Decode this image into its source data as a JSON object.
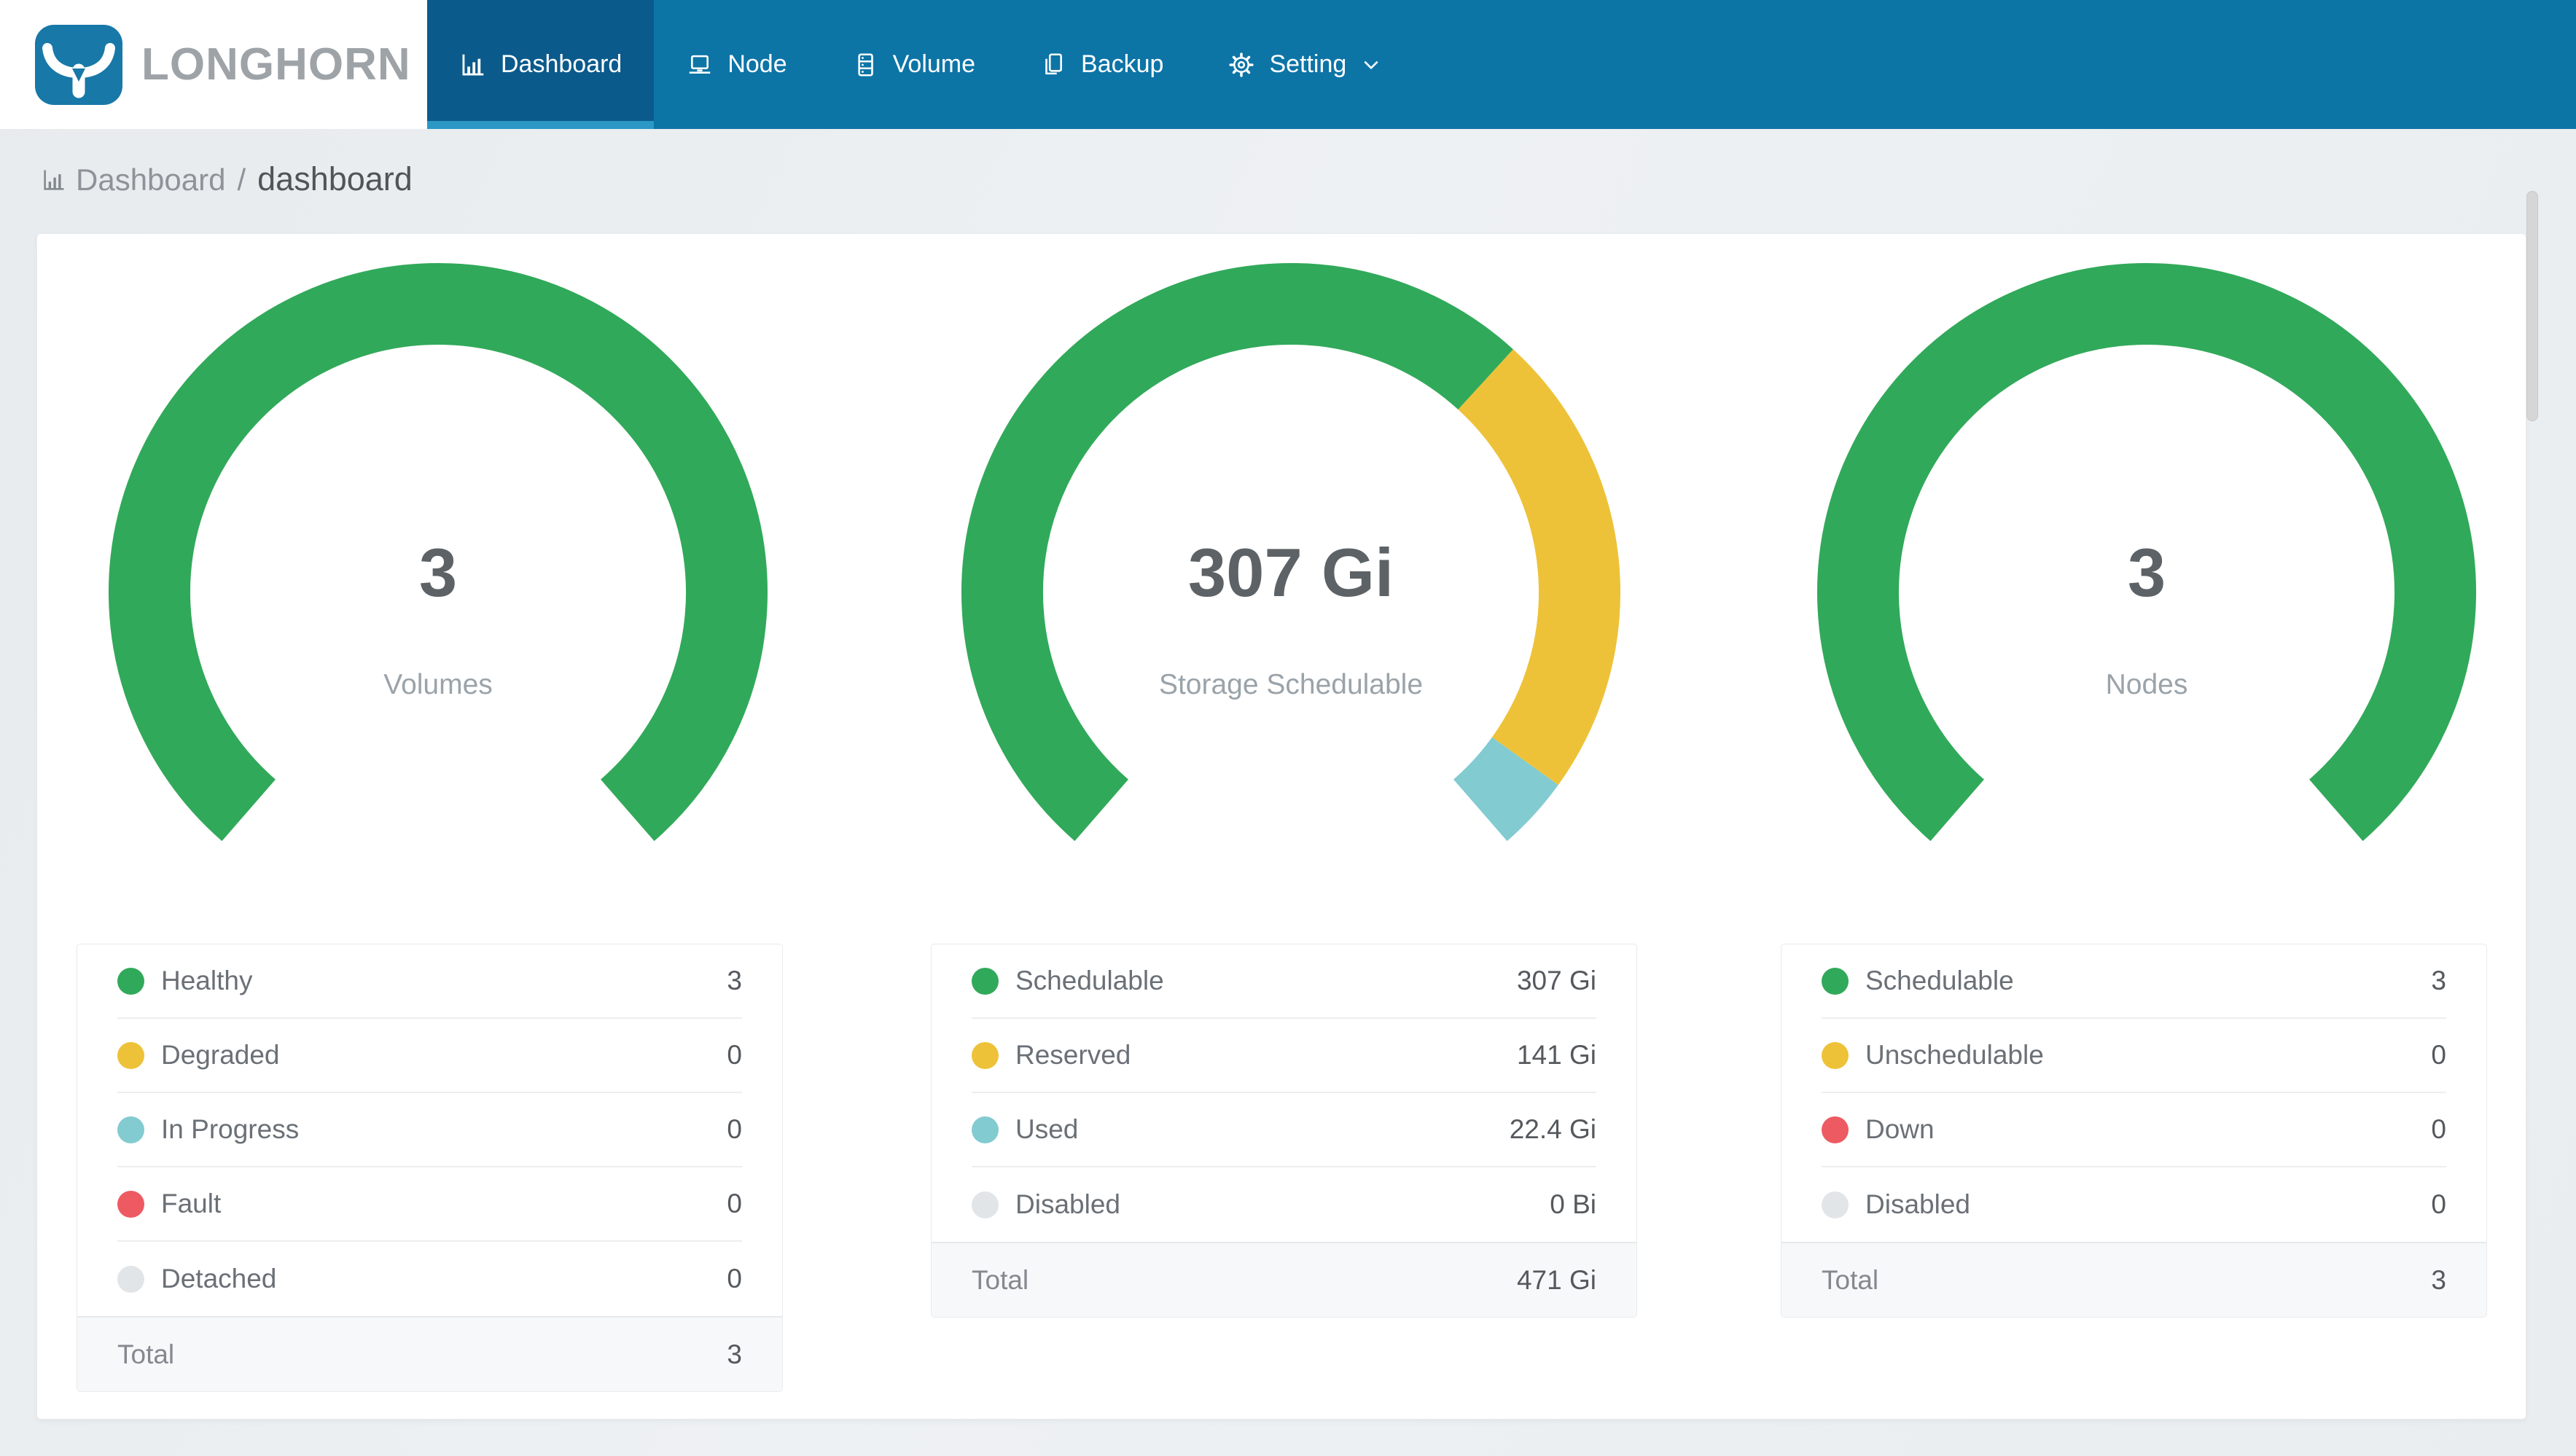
{
  "nav": {
    "brand": "LONGHORN",
    "items": [
      {
        "label": "Dashboard",
        "icon": "bar-chart-icon",
        "active": true
      },
      {
        "label": "Node",
        "icon": "laptop-icon",
        "active": false
      },
      {
        "label": "Volume",
        "icon": "server-icon",
        "active": false
      },
      {
        "label": "Backup",
        "icon": "copy-icon",
        "active": false
      },
      {
        "label": "Setting",
        "icon": "gear-icon",
        "active": false,
        "has_dropdown": true
      }
    ]
  },
  "breadcrumb": {
    "section": "Dashboard",
    "separator": "/",
    "page": "dashboard"
  },
  "colors": {
    "green": "#31a95a",
    "yellow": "#eec238",
    "teal": "#82cbd1",
    "red": "#ee5a62",
    "gray": "#e2e5e8",
    "nav_blue": "#0d74a6",
    "nav_active": "#0b5a8c",
    "nav_underline": "#2b98c6",
    "logo_blue": "#1878a8",
    "brand_text": "#9ea3a8"
  },
  "cards": [
    {
      "gauge": {
        "value_text": "3",
        "label": "Volumes"
      },
      "rows": [
        {
          "label": "Healthy",
          "color": "green",
          "value": 3,
          "value_text": "3"
        },
        {
          "label": "Degraded",
          "color": "yellow",
          "value": 0,
          "value_text": "0"
        },
        {
          "label": "In Progress",
          "color": "teal",
          "value": 0,
          "value_text": "0"
        },
        {
          "label": "Fault",
          "color": "red",
          "value": 0,
          "value_text": "0"
        },
        {
          "label": "Detached",
          "color": "gray",
          "value": 0,
          "value_text": "0"
        }
      ],
      "total": {
        "label": "Total",
        "value_text": "3"
      }
    },
    {
      "gauge": {
        "value_text": "307 Gi",
        "label": "Storage Schedulable"
      },
      "rows": [
        {
          "label": "Schedulable",
          "color": "green",
          "value": 307,
          "value_text": "307 Gi"
        },
        {
          "label": "Reserved",
          "color": "yellow",
          "value": 141,
          "value_text": "141 Gi"
        },
        {
          "label": "Used",
          "color": "teal",
          "value": 22.4,
          "value_text": "22.4 Gi"
        },
        {
          "label": "Disabled",
          "color": "gray",
          "value": 0,
          "value_text": "0 Bi"
        }
      ],
      "total": {
        "label": "Total",
        "value_text": "471 Gi"
      }
    },
    {
      "gauge": {
        "value_text": "3",
        "label": "Nodes"
      },
      "rows": [
        {
          "label": "Schedulable",
          "color": "green",
          "value": 3,
          "value_text": "3"
        },
        {
          "label": "Unschedulable",
          "color": "yellow",
          "value": 0,
          "value_text": "0"
        },
        {
          "label": "Down",
          "color": "red",
          "value": 0,
          "value_text": "0"
        },
        {
          "label": "Disabled",
          "color": "gray",
          "value": 0,
          "value_text": "0"
        }
      ],
      "total": {
        "label": "Total",
        "value_text": "3"
      }
    }
  ],
  "gauge_geometry": {
    "start_angle_deg": 131,
    "sweep_deg": 278
  }
}
